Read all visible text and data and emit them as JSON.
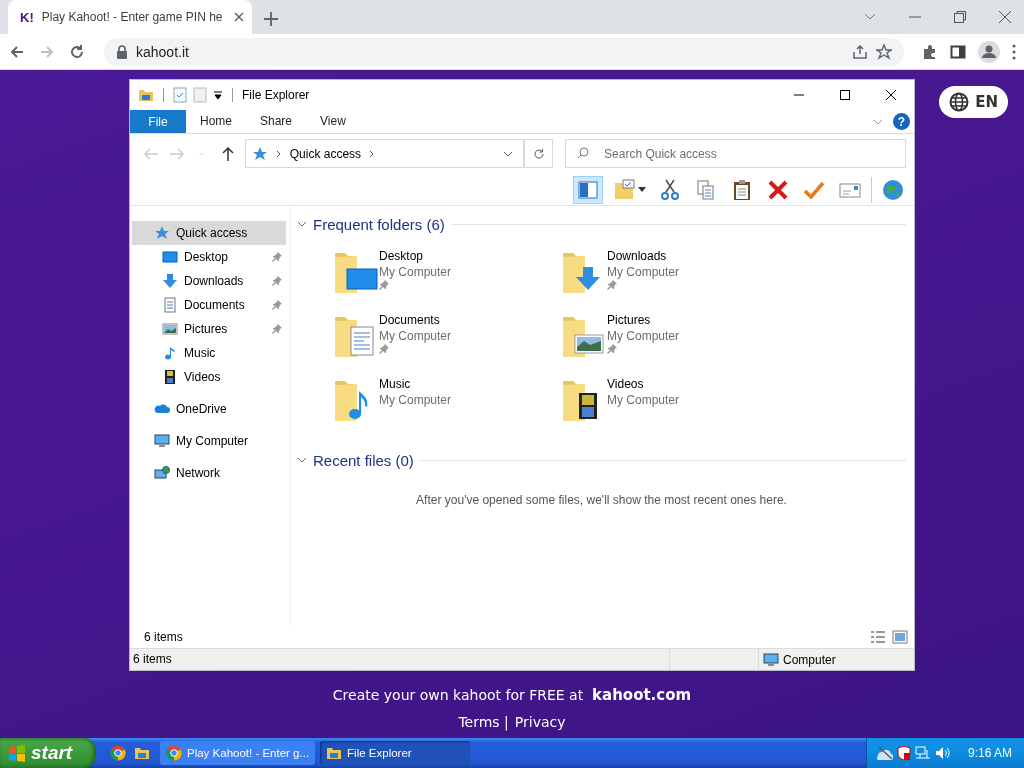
{
  "browser": {
    "tab": {
      "favicon": "K!",
      "title": "Play Kahoot! - Enter game PIN he"
    },
    "nav": [
      {
        "kind": "back",
        "disabled": false
      },
      {
        "kind": "forward",
        "disabled": true
      },
      {
        "kind": "reload",
        "disabled": false
      }
    ],
    "address": "kahoot.it"
  },
  "page": {
    "language_button": "EN",
    "promo": "Create your own kahoot for FREE at  **kahoot.com**",
    "links": [
      "Terms |",
      "Privacy"
    ]
  },
  "explorer": {
    "title": "File Explorer",
    "file_button": "File",
    "ribbon_tabs": [
      {
        "label": "Home",
        "selected": false
      },
      {
        "label": "Share",
        "selected": false
      },
      {
        "label": "View",
        "selected": false
      }
    ],
    "help_button": "?",
    "nav_buttons": [
      {
        "kind": "back",
        "disabled": true
      },
      {
        "kind": "forward",
        "disabled": true
      },
      {
        "kind": "recent",
        "disabled": true
      },
      {
        "kind": "up",
        "disabled": false
      }
    ],
    "breadcrumb": "Quick access",
    "search": {
      "placeholder": "Search Quick access"
    },
    "preview_pane": {
      "on": true
    },
    "toolbar": [
      {
        "kind": "pane"
      },
      {
        "kind": "new-folder"
      },
      {
        "kind": "cut"
      },
      {
        "kind": "copy"
      },
      {
        "kind": "paste"
      },
      {
        "kind": "delete"
      },
      {
        "kind": "check"
      },
      {
        "kind": "envelope"
      },
      {
        "kind": "globe"
      }
    ],
    "sidebar": [
      {
        "label": "Quick access",
        "kind": "quick-access",
        "selected": true,
        "children": [
          {
            "label": "Desktop",
            "kind": "desktop",
            "pinned": true,
            "selected": false
          },
          {
            "label": "Downloads",
            "kind": "downloads",
            "pinned": true,
            "selected": false
          },
          {
            "label": "Documents",
            "kind": "documents",
            "pinned": true,
            "selected": false
          },
          {
            "label": "Pictures",
            "kind": "pictures",
            "pinned": true,
            "selected": false
          },
          {
            "label": "Music",
            "kind": "music",
            "pinned": false,
            "selected": false
          },
          {
            "label": "Videos",
            "kind": "videos",
            "pinned": false,
            "selected": false
          }
        ]
      },
      {
        "label": "OneDrive",
        "kind": "onedrive",
        "selected": false
      },
      {
        "label": "My Computer",
        "kind": "computer",
        "selected": false
      },
      {
        "label": "Network",
        "kind": "network",
        "selected": false
      }
    ],
    "sections": [
      {
        "title": "Frequent folders (6)",
        "expanded": true,
        "folders": [
          {
            "name": "Desktop",
            "location": "My Computer",
            "kind": "desktop",
            "pinned": true
          },
          {
            "name": "Downloads",
            "location": "My Computer",
            "kind": "downloads",
            "pinned": true
          },
          {
            "name": "Documents",
            "location": "My Computer",
            "kind": "documents",
            "pinned": true
          },
          {
            "name": "Pictures",
            "location": "My Computer",
            "kind": "pictures",
            "pinned": true
          },
          {
            "name": "Music",
            "location": "My Computer",
            "kind": "music",
            "pinned": false
          },
          {
            "name": "Videos",
            "location": "My Computer",
            "kind": "videos",
            "pinned": false
          }
        ]
      },
      {
        "title": "Recent files (0)",
        "expanded": true,
        "empty_message": "After you've opened some files, we'll show the most recent ones here."
      }
    ],
    "item_count": "6 items",
    "status_bar": {
      "left": "6 items",
      "right": "Computer"
    }
  },
  "taskbar": {
    "start": "start",
    "quick_launch": [
      {
        "kind": "chrome"
      },
      {
        "kind": "folder"
      }
    ],
    "tasks": [
      {
        "label": "Play Kahoot! - Enter g...",
        "kind": "chrome",
        "selected": false
      },
      {
        "label": "File Explorer",
        "kind": "folder",
        "selected": true
      }
    ],
    "clock": "9:16 AM"
  }
}
